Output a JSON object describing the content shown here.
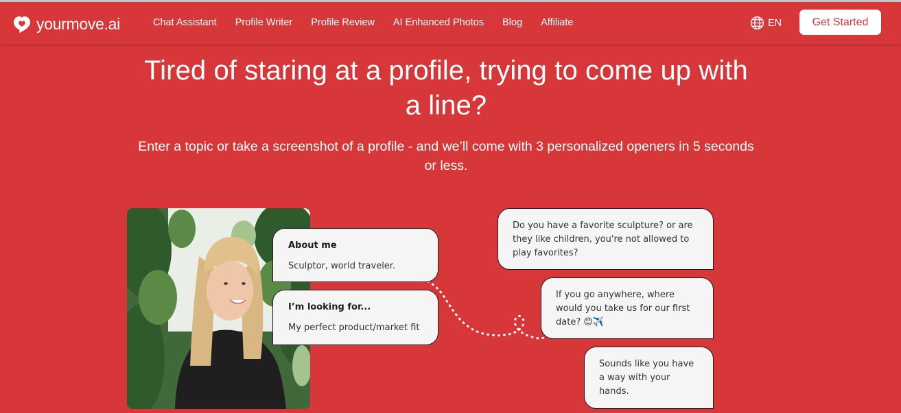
{
  "nav": {
    "brand": "yourmove.ai",
    "links": [
      "Chat Assistant",
      "Profile Writer",
      "Profile Review",
      "AI Enhanced Photos",
      "Blog",
      "Affiliate"
    ],
    "language": "EN",
    "cta": "Get Started"
  },
  "hero": {
    "title": "Tired of staring at a profile, trying to come up with a line?",
    "subtitle": "Enter a topic or take a screenshot of a profile - and we’ll come with 3 personalized openers in 5 seconds or less."
  },
  "profile": {
    "about_title": "About me",
    "about_text": "Sculptor, world traveler.",
    "looking_title": "I’m looking for...",
    "looking_text": "My perfect product/market fit"
  },
  "openers": [
    "Do you have a favorite sculpture? or are they like children, you're not allowed to play favorites?",
    "If you go anywhere, where would you take us for our first date? 😊✈️",
    "Sounds like you have a way with your hands."
  ],
  "colors": {
    "brand_red": "#d8373a",
    "bubble_bg": "#f5f5f5",
    "bubble_border": "#1e1e1e"
  }
}
